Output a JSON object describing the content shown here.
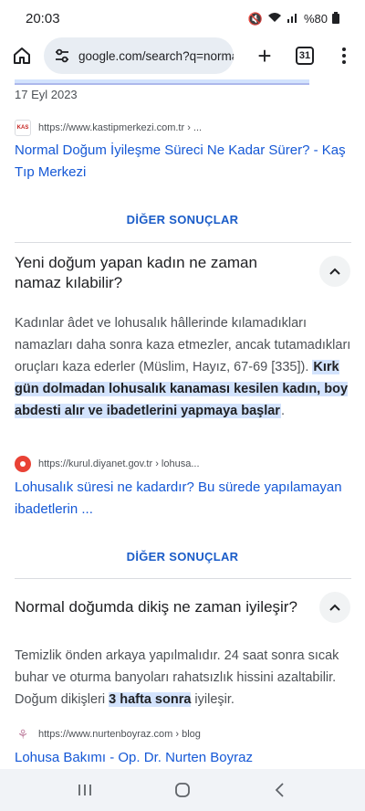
{
  "status": {
    "time": "20:03",
    "network": "Vo))\nLTE2",
    "battery": "%80"
  },
  "toolbar": {
    "url": "google.com/search?q=normal-",
    "tab_count": "31"
  },
  "results_top": {
    "date": "17 Eyl 2023",
    "source_url": "https://www.kastipmerkezi.com.tr › ...",
    "favicon_text": "KAS",
    "title": "Normal Doğum İyileşme Süreci Ne Kadar Sürer? - Kaş Tıp Merkezi",
    "more_label": "DİĞER SONUÇLAR"
  },
  "qa": [
    {
      "question": "Yeni doğum yapan kadın ne zaman namaz kılabilir?",
      "answer_plain": "Kadınlar âdet ve lohusalık hâllerinde kılamadıkları namazları daha sonra kaza etmezler, ancak tutamadıkları oruçları kaza ederler (Müslim, Hayız, 67-69 [335]). ",
      "answer_highlight": "Kırk gün dolmadan lohusalık kanaması kesilen kadın, boy abdesti alır ve ibadetlerini yapmaya başlar",
      "answer_end": ".",
      "source_url": "https://kurul.diyanet.gov.tr › lohusa...",
      "title": "Lohusalık süresi ne kadardır? Bu sürede yapılamayan ibadetlerin ...",
      "more_label": "DİĞER SONUÇLAR"
    },
    {
      "question": "Normal doğumda dikiş ne zaman iyileşir?",
      "answer_plain": "Temizlik önden arkaya yapılmalıdır. 24 saat sonra sıcak buhar ve oturma banyoları rahatsızlık hissini azaltabilir. Doğum dikişleri ",
      "answer_highlight": "3 hafta sonra",
      "answer_end": " iyileşir.",
      "source_url": "https://www.nurtenboyraz.com › blog",
      "title": "Lohusa Bakımı - Op. Dr. Nurten Boyraz"
    }
  ]
}
